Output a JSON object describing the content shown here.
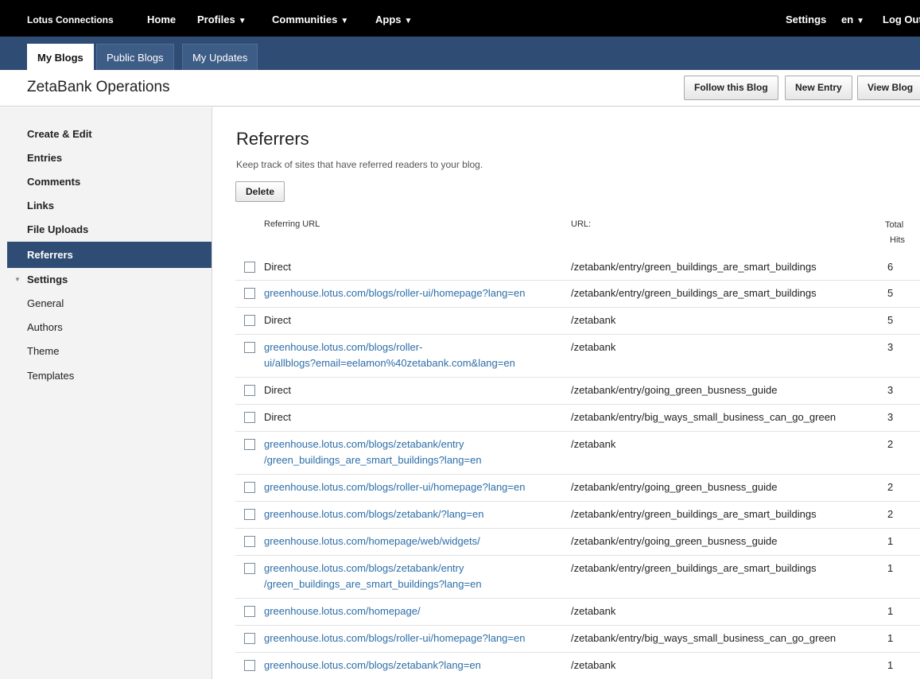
{
  "topnav": {
    "brand": "Lotus Connections",
    "home": "Home",
    "profiles": "Profiles",
    "communities": "Communities",
    "apps": "Apps",
    "settings": "Settings",
    "lang": "en",
    "logout": "Log Out",
    "caret": "▼"
  },
  "tabs": [
    "My Blogs",
    "Public Blogs",
    "My Updates"
  ],
  "header": {
    "blog_title": "ZetaBank Operations",
    "follow": "Follow this Blog",
    "new_entry": "New Entry",
    "view_blog": "View Blog"
  },
  "sidebar": {
    "items": [
      "Create & Edit",
      "Entries",
      "Comments",
      "Links",
      "File Uploads",
      "Referrers",
      "Settings",
      "General",
      "Authors",
      "Theme",
      "Templates"
    ],
    "active": "Referrers"
  },
  "main": {
    "title": "Referrers",
    "description": "Keep track of sites that have referred readers to your blog.",
    "delete_label": "Delete",
    "col_referring": "Referring URL",
    "col_url": "URL:",
    "col_total": "Total",
    "col_hits": "Hits"
  },
  "rows": [
    {
      "referrer": "Direct",
      "url": "/zetabank/entry/green_buildings_are_smart_buildings",
      "hits": "6"
    },
    {
      "referrer": "greenhouse.lotus.com/blogs/roller-ui/homepage?lang=en",
      "url": "/zetabank/entry/green_buildings_are_smart_buildings",
      "hits": "5"
    },
    {
      "referrer": "Direct",
      "url": "/zetabank",
      "hits": "5"
    },
    {
      "referrer": "greenhouse.lotus.com/blogs/roller-\nui/allblogs?email=eelamon%40zetabank.com&lang=en",
      "url": "/zetabank",
      "hits": "3"
    },
    {
      "referrer": "Direct",
      "url": "/zetabank/entry/going_green_busness_guide",
      "hits": "3"
    },
    {
      "referrer": "Direct",
      "url": "/zetabank/entry/big_ways_small_business_can_go_green",
      "hits": "3"
    },
    {
      "referrer": "greenhouse.lotus.com/blogs/zetabank/entry\n/green_buildings_are_smart_buildings?lang=en",
      "url": "/zetabank",
      "hits": "2"
    },
    {
      "referrer": "greenhouse.lotus.com/blogs/roller-ui/homepage?lang=en",
      "url": "/zetabank/entry/going_green_busness_guide",
      "hits": "2"
    },
    {
      "referrer": "greenhouse.lotus.com/blogs/zetabank/?lang=en",
      "url": "/zetabank/entry/green_buildings_are_smart_buildings",
      "hits": "2"
    },
    {
      "referrer": "greenhouse.lotus.com/homepage/web/widgets/",
      "url": "/zetabank/entry/going_green_busness_guide",
      "hits": "1"
    },
    {
      "referrer": "greenhouse.lotus.com/blogs/zetabank/entry\n/green_buildings_are_smart_buildings?lang=en",
      "url": "/zetabank/entry/green_buildings_are_smart_buildings",
      "hits": "1"
    },
    {
      "referrer": "greenhouse.lotus.com/homepage/",
      "url": "/zetabank",
      "hits": "1"
    },
    {
      "referrer": "greenhouse.lotus.com/blogs/roller-ui/homepage?lang=en",
      "url": "/zetabank/entry/big_ways_small_business_can_go_green",
      "hits": "1"
    },
    {
      "referrer": "greenhouse.lotus.com/blogs/zetabank?lang=en",
      "url": "/zetabank",
      "hits": "1"
    }
  ],
  "colors": {
    "nav_bg": "#000000",
    "tabbar_bg": "#2f4d74",
    "link": "#2d6ea8",
    "active_bg": "#2f4d74"
  }
}
